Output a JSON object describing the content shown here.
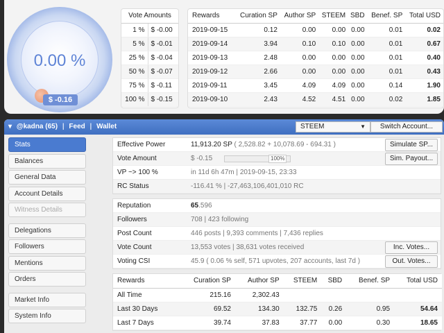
{
  "gauge": {
    "percent": "0.00 %",
    "value": "$ -0.16"
  },
  "vote_amounts": {
    "header": "Vote Amounts",
    "rows": [
      {
        "pct": "1 %",
        "val": "$ -0.00"
      },
      {
        "pct": "5 %",
        "val": "$ -0.01"
      },
      {
        "pct": "25 %",
        "val": "$ -0.04"
      },
      {
        "pct": "50 %",
        "val": "$ -0.07"
      },
      {
        "pct": "75 %",
        "val": "$ -0.11"
      },
      {
        "pct": "100 %",
        "val": "$ -0.15"
      }
    ]
  },
  "rewards_daily": {
    "headers": [
      "Rewards",
      "Curation SP",
      "Author SP",
      "STEEM",
      "SBD",
      "Benef. SP",
      "Total USD"
    ],
    "rows": [
      [
        "2019-09-15",
        "0.12",
        "0.00",
        "0.00",
        "0.00",
        "0.01",
        "0.02"
      ],
      [
        "2019-09-14",
        "3.94",
        "0.10",
        "0.10",
        "0.00",
        "0.01",
        "0.67"
      ],
      [
        "2019-09-13",
        "2.48",
        "0.00",
        "0.00",
        "0.00",
        "0.01",
        "0.40"
      ],
      [
        "2019-09-12",
        "2.66",
        "0.00",
        "0.00",
        "0.00",
        "0.01",
        "0.43"
      ],
      [
        "2019-09-11",
        "3.45",
        "4.09",
        "4.09",
        "0.00",
        "0.14",
        "1.90"
      ],
      [
        "2019-09-10",
        "2.43",
        "4.52",
        "4.51",
        "0.00",
        "0.02",
        "1.85"
      ]
    ]
  },
  "header": {
    "user": "@kadna (65)",
    "sep": "|",
    "feed": "Feed",
    "wallet": "Wallet",
    "currency": "STEEM",
    "switch_account": "Switch Account..."
  },
  "sidebar": {
    "items": [
      {
        "label": "Stats"
      },
      {
        "label": "Balances"
      },
      {
        "label": "General Data"
      },
      {
        "label": "Account Details"
      },
      {
        "label": "Witness Details"
      },
      {
        "label": "Delegations"
      },
      {
        "label": "Followers"
      },
      {
        "label": "Mentions"
      },
      {
        "label": "Orders"
      },
      {
        "label": "Market Info"
      },
      {
        "label": "System Info"
      }
    ]
  },
  "stats": {
    "effective_power_label": "Effective Power",
    "effective_power_value": "11,913.20 SP",
    "effective_power_detail": "( 2,528.82 + 10,078.69 - 694.31 )",
    "simulate_sp": "Simulate SP...",
    "vote_amount_label": "Vote Amount",
    "vote_amount_value": "$ -0.15",
    "vote_slider_pct": "100%",
    "sim_payout": "Sim. Payout...",
    "vp_label": "VP ~> 100 %",
    "vp_value": "in 11d 6h 47m",
    "vp_sep": "|",
    "vp_date": "2019-09-15, 23:33",
    "rc_label": "RC Status",
    "rc_pct": "-116.41 %",
    "rc_sep": "|",
    "rc_value": "-27,463,106,401,010 RC"
  },
  "profile": {
    "reputation_label": "Reputation",
    "reputation_main": "65",
    "reputation_dec": ".596",
    "followers_label": "Followers",
    "followers_value": "708",
    "followers_sep": "|",
    "following_value": "423 following",
    "post_count_label": "Post Count",
    "posts": "446 posts",
    "posts_sep1": "|",
    "comments": "9,393 comments",
    "posts_sep2": "|",
    "replies": "7,436 replies",
    "vote_count_label": "Vote Count",
    "votes": "13,553 votes",
    "votes_sep": "|",
    "votes_received": "38,631 votes received",
    "inc_votes": "Inc. Votes...",
    "csi_label": "Voting CSI",
    "csi_value": "45.9 ( 0.06 % self, 571 upvotes, 207 accounts, last 7d )",
    "out_votes": "Out. Votes..."
  },
  "rewards_summary": {
    "headers": [
      "Rewards",
      "Curation SP",
      "Author SP",
      "STEEM",
      "SBD",
      "Benef. SP",
      "Total USD"
    ],
    "rows": [
      [
        "All Time",
        "215.16",
        "2,302.43",
        "",
        "",
        "",
        ""
      ],
      [
        "Last 30 Days",
        "69.52",
        "134.30",
        "132.75",
        "0.26",
        "0.95",
        "54.64"
      ],
      [
        "Last 7 Days",
        "39.74",
        "37.83",
        "37.77",
        "0.00",
        "0.30",
        "18.65"
      ]
    ]
  }
}
